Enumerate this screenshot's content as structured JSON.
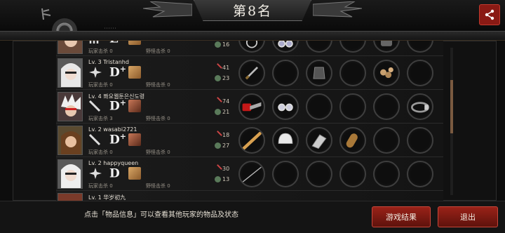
{
  "header": {
    "title": "第8名",
    "share_icon": "share-icon"
  },
  "players": [
    {
      "level_name": "",
      "skill_icon": "claw-icon",
      "grade": "E",
      "grade_plus": "",
      "player_kills_label": "玩家击杀",
      "player_kills": "0",
      "monster_kills_label": "野怪击杀",
      "monster_kills": "0",
      "stat_a": "",
      "stat_b": "16",
      "items": [
        "ring-icon",
        "glasses-icon",
        "empty",
        "empty",
        "glove-icon",
        "empty"
      ]
    },
    {
      "level_name": "Lv. 3   Tristanhd",
      "skill_icon": "shuriken-icon",
      "grade": "D",
      "grade_plus": "+",
      "player_kills_label": "玩家击杀",
      "player_kills": "0",
      "monster_kills_label": "野怪击杀",
      "monster_kills": "0",
      "stat_a": "41",
      "stat_b": "23",
      "items": [
        "knife-icon",
        "empty",
        "armor-icon",
        "empty",
        "chain-icon",
        "empty"
      ]
    },
    {
      "level_name": "Lv. 4   쫘요웹툰은신도령",
      "skill_icon": "sword-icon",
      "grade": "D",
      "grade_plus": "+",
      "player_kills_label": "玩家击杀",
      "player_kills": "3",
      "monster_kills_label": "野怪击杀",
      "monster_kills": "0",
      "stat_a": "74",
      "stat_b": "21",
      "items": [
        "chainsaw-icon",
        "glasses-icon",
        "empty",
        "empty",
        "empty",
        "belt-icon"
      ]
    },
    {
      "level_name": "Lv. 2   wasabi2721",
      "skill_icon": "sword-icon",
      "grade": "D",
      "grade_plus": "+",
      "player_kills_label": "玩家击杀",
      "player_kills": "0",
      "monster_kills_label": "野怪击杀",
      "monster_kills": "0",
      "stat_a": "18",
      "stat_b": "27",
      "items": [
        "bat-icon",
        "helmet-icon",
        "gauntlet-icon",
        "capsule-icon",
        "empty",
        "empty"
      ]
    },
    {
      "level_name": "Lv. 2   happyqueen",
      "skill_icon": "shuriken-icon",
      "grade": "D",
      "grade_plus": "",
      "player_kills_label": "玩家击杀",
      "player_kills": "0",
      "monster_kills_label": "野怪击杀",
      "monster_kills": "0",
      "stat_a": "30",
      "stat_b": "13",
      "items": [
        "needle-icon",
        "empty",
        "empty",
        "empty",
        "empty",
        "empty"
      ]
    },
    {
      "level_name": "Lv. 1   华岁初九",
      "skill_icon": "",
      "grade": "",
      "grade_plus": "",
      "player_kills_label": "",
      "player_kills": "",
      "monster_kills_label": "",
      "monster_kills": "",
      "stat_a": "",
      "stat_b": "",
      "items": [
        "empty",
        "empty",
        "empty",
        "empty",
        "empty",
        "empty"
      ]
    }
  ],
  "footer": {
    "hint": "点击「物品信息」可以查看其他玩家的物品及状态",
    "result_button": "游戏结果",
    "exit_button": "退出"
  },
  "colors": {
    "accent_red": "#9a2218",
    "gold": "#7a5a40"
  }
}
